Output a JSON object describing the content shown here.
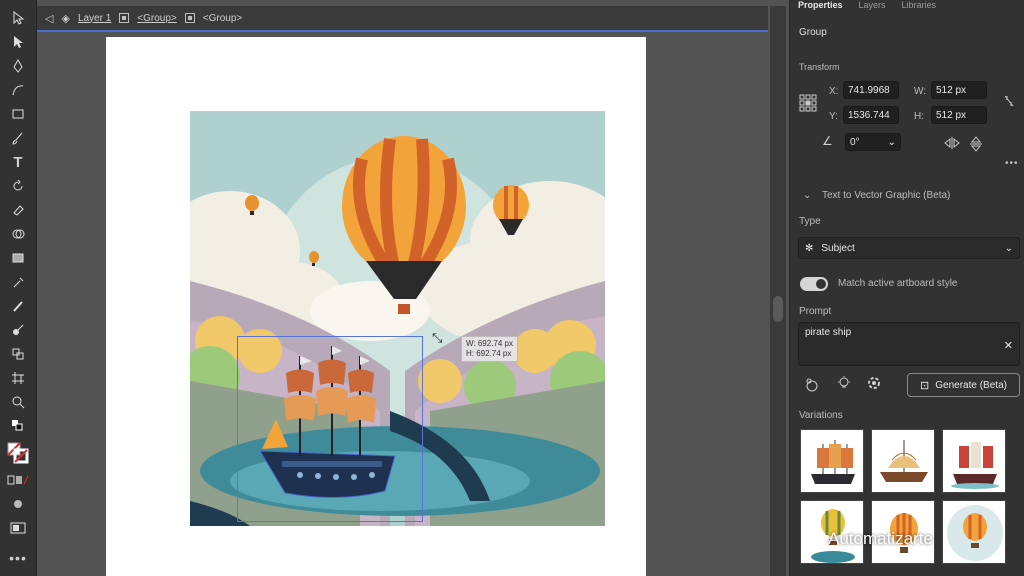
{
  "breadcrumb": {
    "layer": "Layer 1",
    "group1": "<Group>",
    "group2": "<Group>"
  },
  "canvas": {
    "tooltip_w": "W: 692.74 px",
    "tooltip_h": "H: 692.74 px"
  },
  "panel": {
    "tabs": [
      "Properties",
      "Layers",
      "Libraries"
    ],
    "selection": "Group",
    "transform_title": "Transform",
    "x_label": "X:",
    "x_value": "741.9968",
    "y_label": "Y:",
    "y_value": "1536.744",
    "w_label": "W:",
    "w_value": "512 px",
    "h_label": "H:",
    "h_value": "512 px",
    "angle_value": "0°",
    "ttv_title": "Text to Vector Graphic (Beta)",
    "type_label": "Type",
    "type_value": "Subject",
    "match_label": "Match active artboard style",
    "prompt_label": "Prompt",
    "prompt_value": "pirate ship",
    "generate_label": "Generate (Beta)",
    "variations_label": "Variations",
    "more": "•••"
  },
  "watermark": "Automatizarte",
  "colors": {
    "accent": "#4b6fd0",
    "panel_bg": "#323232",
    "canvas_bg": "#535353"
  }
}
